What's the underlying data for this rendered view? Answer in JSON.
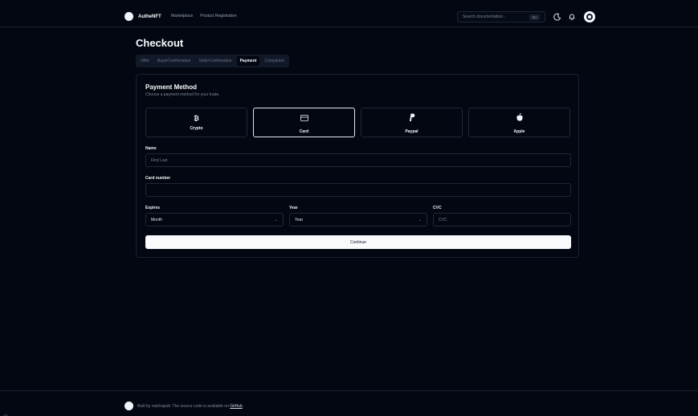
{
  "header": {
    "brand": "AutheNFT",
    "nav": [
      "Marketplace",
      "Product Registration"
    ],
    "search_placeholder": "Search documentation...",
    "search_shortcut": "⌘K"
  },
  "page": {
    "title": "Checkout",
    "tabs": [
      "Offer",
      "BuyerConfirmation",
      "SellerConfirmation",
      "Payment",
      "Completed"
    ],
    "active_tab": "Payment"
  },
  "payment": {
    "title": "Payment Method",
    "description": "Choose a payment method for your trade.",
    "methods": [
      {
        "label": "Crypto",
        "icon": "bitcoin-icon"
      },
      {
        "label": "Card",
        "icon": "credit-card-icon"
      },
      {
        "label": "Paypal",
        "icon": "paypal-icon"
      },
      {
        "label": "Apple",
        "icon": "apple-icon"
      }
    ],
    "selected_method": "Card",
    "name_label": "Name",
    "name_placeholder": "First Last",
    "card_label": "Card number",
    "card_value": "",
    "expires_label": "Expires",
    "expires_value": "Month",
    "year_label": "Year",
    "year_value": "Year",
    "cvc_label": "CVC",
    "cvc_placeholder": "CVC",
    "continue_label": "Continue"
  },
  "footer": {
    "text": "Built by natchapolt. The source code is available on",
    "link": "GitHub",
    "suffix": "."
  }
}
